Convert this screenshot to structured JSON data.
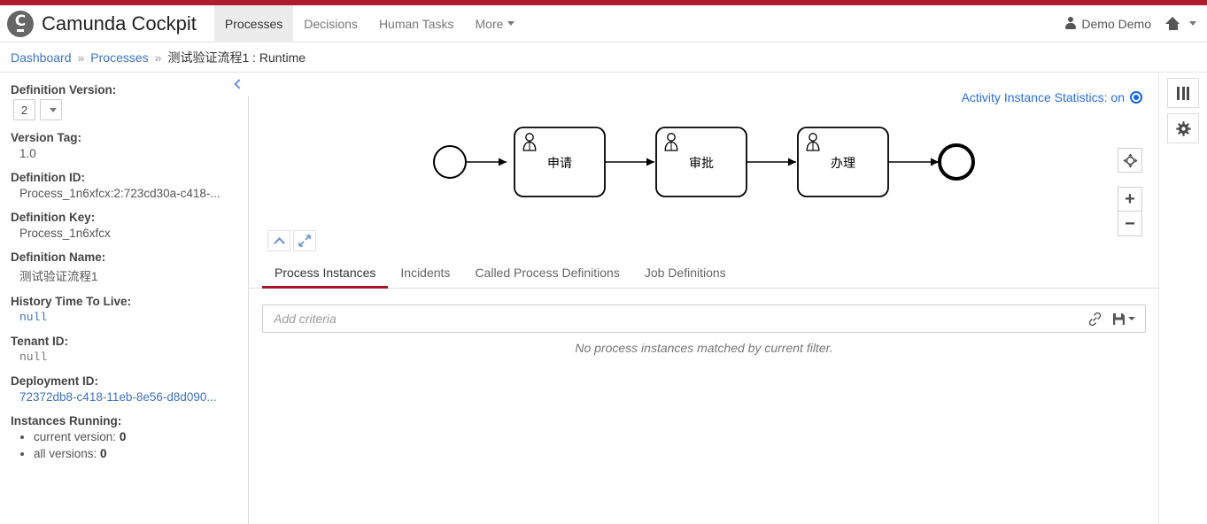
{
  "colors": {
    "accent_red": "#b01c2e",
    "tab_active_underline": "#a4152c",
    "link_blue": "#3f72c3",
    "toggle_blue": "#1565e8"
  },
  "header": {
    "logo_icon": "camunda-logo-icon",
    "brand_title": "Camunda Cockpit",
    "nav": [
      {
        "label": "Processes",
        "active": true
      },
      {
        "label": "Decisions",
        "active": false
      },
      {
        "label": "Human Tasks",
        "active": false
      },
      {
        "label": "More",
        "active": false,
        "has_caret": true
      }
    ],
    "user": {
      "icon": "person-icon",
      "name": "Demo Demo"
    },
    "home": {
      "icon": "home-icon",
      "has_caret": true
    }
  },
  "breadcrumb": {
    "items": [
      {
        "label": "Dashboard",
        "link": true
      },
      {
        "label": "Processes",
        "link": true
      },
      {
        "label": "测试验证流程1 : Runtime",
        "link": false
      }
    ],
    "separator": "»"
  },
  "sidebar": {
    "collapse_icon": "chevron-left-icon",
    "definition_version": {
      "label": "Definition Version:",
      "value": "2",
      "dropdown_icon": "caret-down-icon"
    },
    "version_tag": {
      "label": "Version Tag:",
      "value": "1.0"
    },
    "definition_id": {
      "label": "Definition ID:",
      "value": "Process_1n6xfcx:2:723cd30a-c418-..."
    },
    "definition_key": {
      "label": "Definition Key:",
      "value": "Process_1n6xfcx"
    },
    "definition_name": {
      "label": "Definition Name:",
      "value": "测试验证流程1"
    },
    "history_ttl": {
      "label": "History Time To Live:",
      "value": "null"
    },
    "tenant_id": {
      "label": "Tenant ID:",
      "value": "null"
    },
    "deployment_id": {
      "label": "Deployment ID:",
      "value": "72372db8-c418-11eb-8e56-d8d090..."
    },
    "instances_running": {
      "label": "Instances Running:",
      "items": [
        {
          "label": "current version:",
          "value": "0"
        },
        {
          "label": "all versions:",
          "value": "0"
        }
      ]
    }
  },
  "diagram": {
    "stats_toggle": {
      "label": "Activity Instance Statistics: on",
      "state": "on"
    },
    "zoom_controls": [
      {
        "name": "reset-zoom",
        "icon": "crosshair-icon"
      },
      {
        "name": "zoom-in",
        "icon": "plus-icon",
        "label": "+"
      },
      {
        "name": "zoom-out",
        "icon": "minus-icon",
        "label": "−"
      }
    ],
    "footer_controls": [
      {
        "name": "collapse-diagram",
        "icon": "chevron-up-icon"
      },
      {
        "name": "fullscreen-diagram",
        "icon": "expand-arrows-icon"
      }
    ],
    "bpmn": {
      "start_event": {
        "type": "start-event",
        "label": ""
      },
      "tasks": [
        {
          "type": "user-task",
          "label": "申请"
        },
        {
          "type": "user-task",
          "label": "审批"
        },
        {
          "type": "user-task",
          "label": "办理"
        }
      ],
      "end_event": {
        "type": "end-event",
        "label": ""
      }
    }
  },
  "side_buttons": [
    {
      "name": "pause-button",
      "icon": "pause-icon"
    },
    {
      "name": "settings-button",
      "icon": "gear-icon"
    }
  ],
  "tabs": [
    {
      "label": "Process Instances",
      "active": true
    },
    {
      "label": "Incidents",
      "active": false
    },
    {
      "label": "Called Process Definitions",
      "active": false
    },
    {
      "label": "Job Definitions",
      "active": false
    }
  ],
  "filter": {
    "placeholder": "Add criteria",
    "value": "",
    "actions": [
      {
        "name": "copy-link-button",
        "icon": "link-icon"
      },
      {
        "name": "save-filter-button",
        "icon": "save-disk-icon",
        "has_caret": true
      }
    ]
  },
  "empty_state": {
    "message": "No process instances matched by current filter."
  }
}
